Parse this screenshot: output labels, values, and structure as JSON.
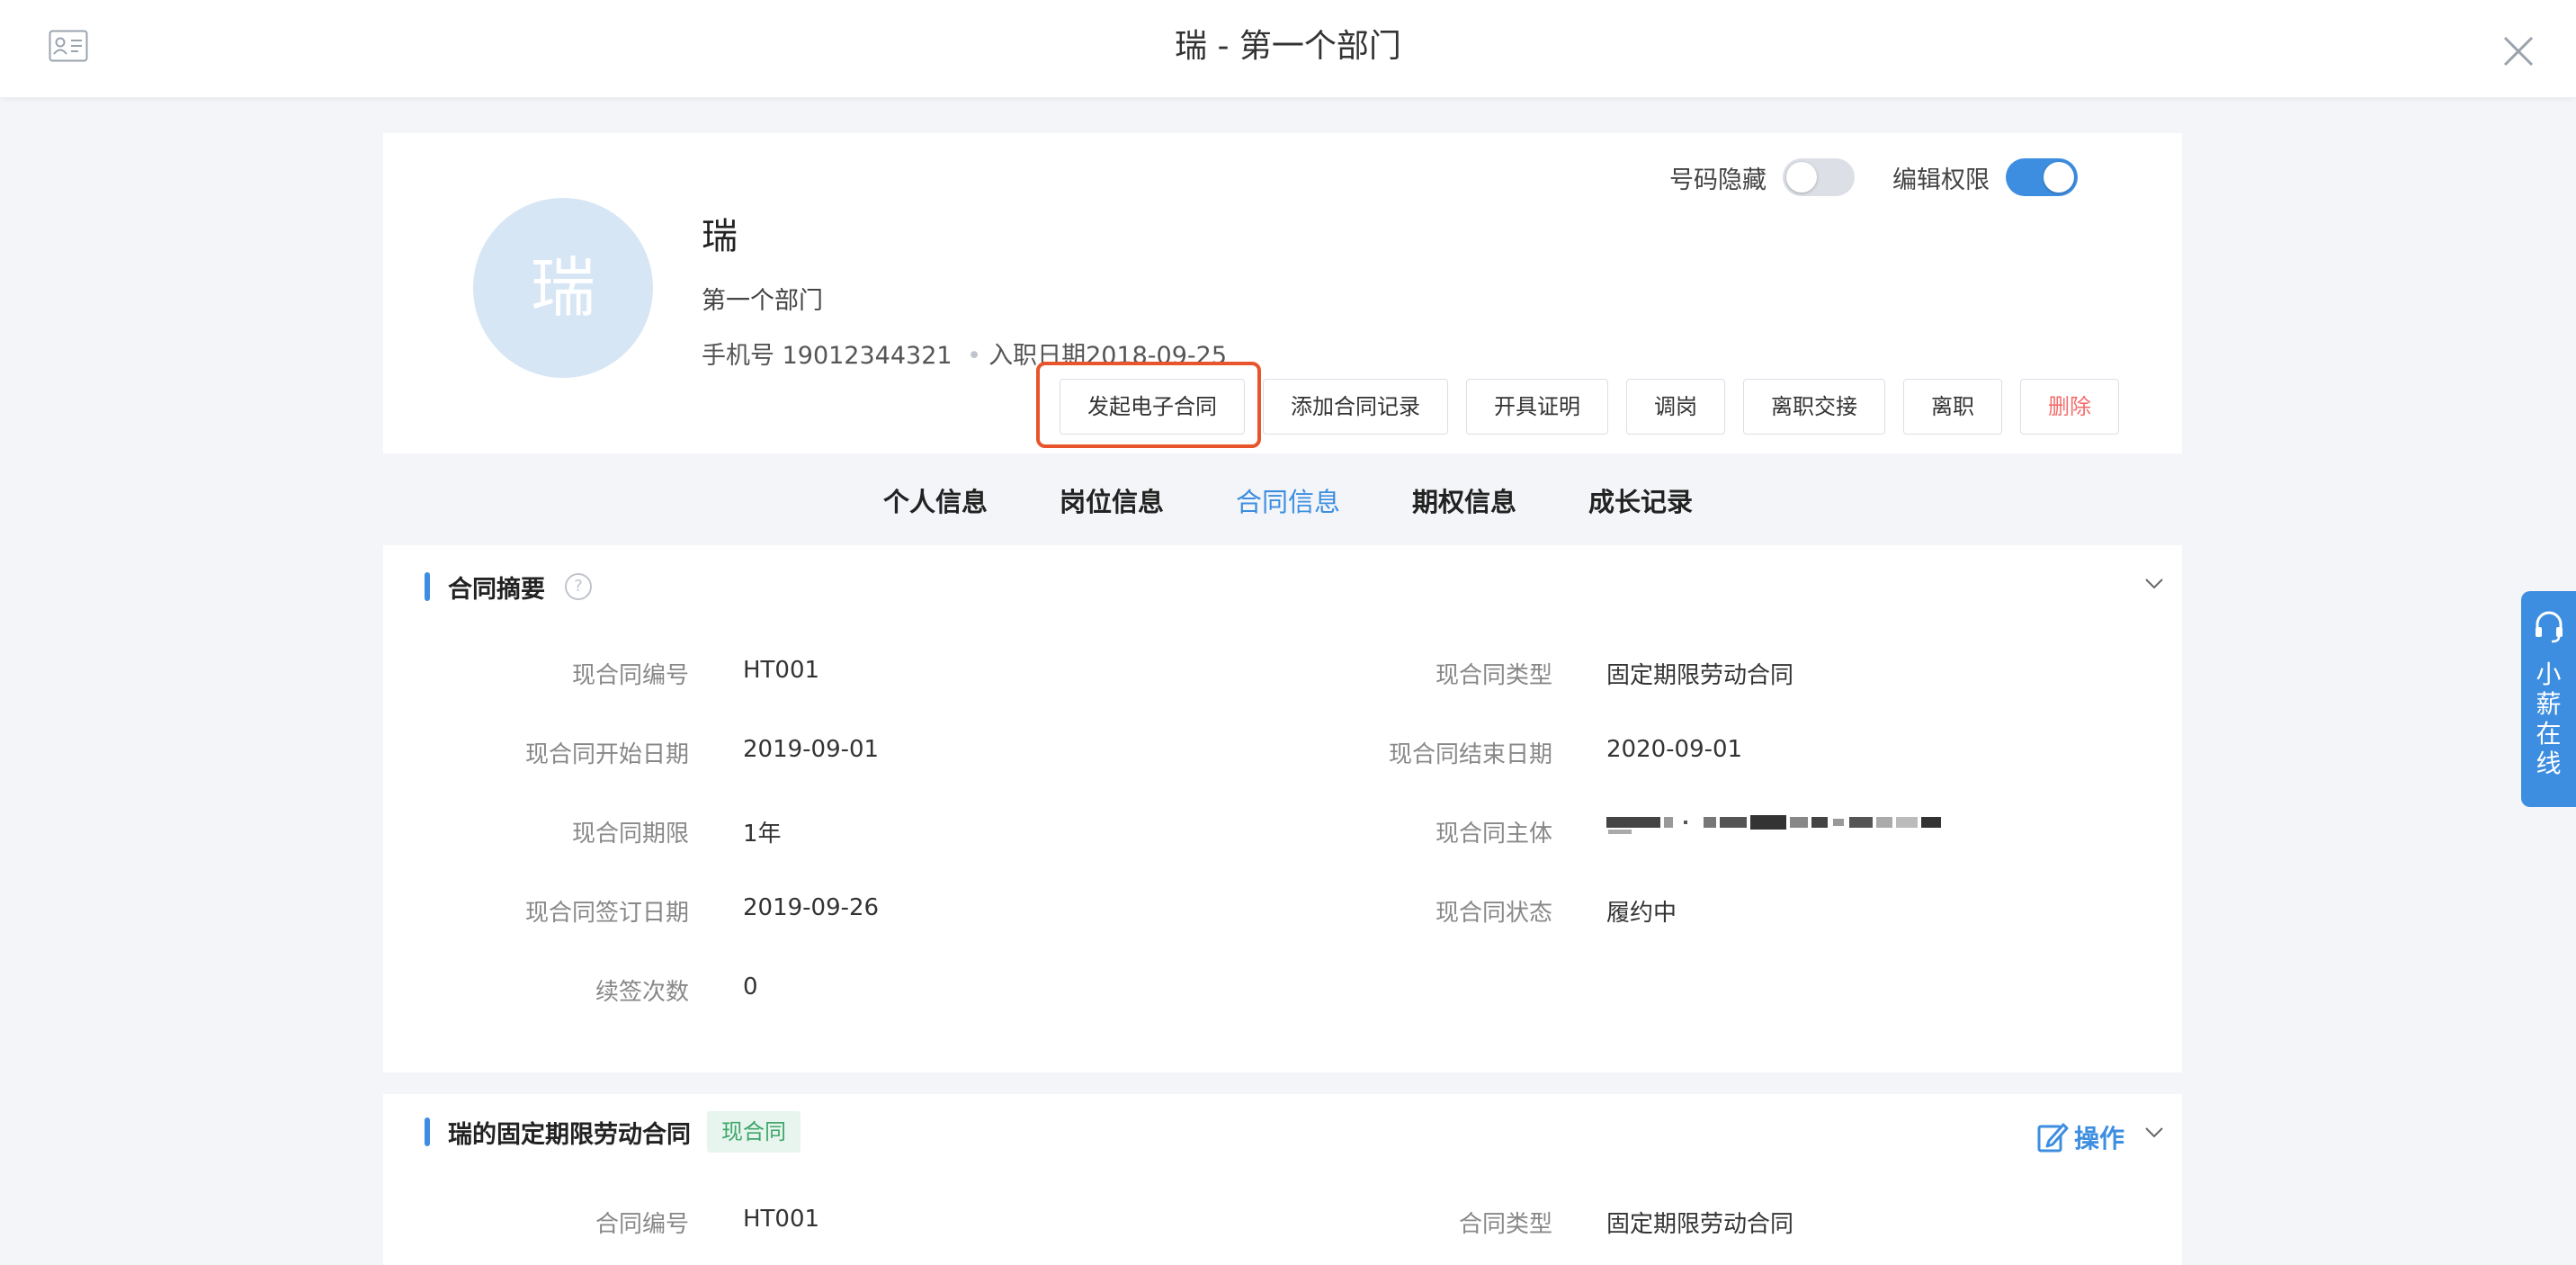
{
  "header": {
    "title": "瑞 - 第一个部门",
    "left_icon": "contact-card-icon",
    "close_icon": "close-icon"
  },
  "profile": {
    "avatar_text": "瑞",
    "name": "瑞",
    "department": "第一个部门",
    "phone_label": "手机号",
    "phone": "19012344321",
    "separator": "•",
    "hire_date_label": "入职日期",
    "hire_date": "2018-09-25",
    "toggles": [
      {
        "label": "号码隐藏",
        "on": false
      },
      {
        "label": "编辑权限",
        "on": true
      }
    ],
    "actions": [
      {
        "label": "发起电子合同"
      },
      {
        "label": "添加合同记录"
      },
      {
        "label": "开具证明"
      },
      {
        "label": "调岗"
      },
      {
        "label": "离职交接"
      },
      {
        "label": "离职"
      },
      {
        "label": "删除",
        "danger": true
      }
    ]
  },
  "tabs": [
    {
      "label": "个人信息"
    },
    {
      "label": "岗位信息"
    },
    {
      "label": "合同信息",
      "active": true
    },
    {
      "label": "期权信息"
    },
    {
      "label": "成长记录"
    }
  ],
  "summary": {
    "title": "合同摘要",
    "help": "?",
    "fields": {
      "contract_no": {
        "label": "现合同编号",
        "value": "HT001"
      },
      "contract_type": {
        "label": "现合同类型",
        "value": "固定期限劳动合同"
      },
      "start_date": {
        "label": "现合同开始日期",
        "value": "2019-09-01"
      },
      "end_date": {
        "label": "现合同结束日期",
        "value": "2020-09-01"
      },
      "term": {
        "label": "现合同期限",
        "value": "1年"
      },
      "entity": {
        "label": "现合同主体",
        "value": ""
      },
      "sign_date": {
        "label": "现合同签订日期",
        "value": "2019-09-26"
      },
      "status": {
        "label": "现合同状态",
        "value": "履约中"
      },
      "renewals": {
        "label": "续签次数",
        "value": "0"
      }
    }
  },
  "contract": {
    "title": "瑞的固定期限劳动合同",
    "tag": "现合同",
    "op_label": "操作",
    "fields": {
      "contract_no": {
        "label": "合同编号",
        "value": "HT001"
      },
      "contract_type": {
        "label": "合同类型",
        "value": "固定期限劳动合同"
      }
    }
  },
  "side_widget": {
    "text": "小薪在线",
    "icon": "headset-icon"
  },
  "colors": {
    "accent": "#3d8ee0",
    "highlight": "#e8542b",
    "danger": "#f56c6c",
    "tag_green": "#3fa66b"
  }
}
